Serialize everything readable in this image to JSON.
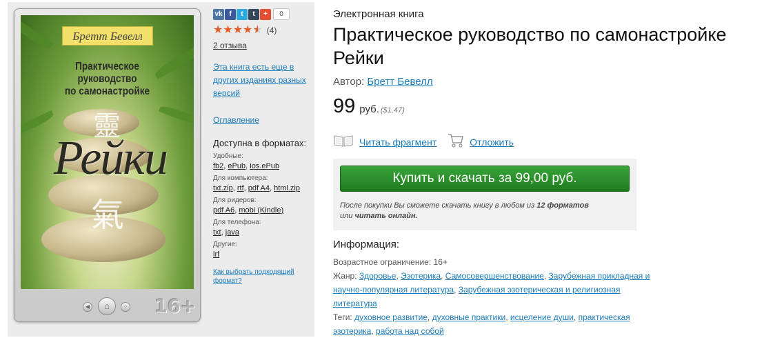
{
  "sidebar": {
    "share_count": "0",
    "rating_count": "(4)",
    "reviews_link": "2 отзыва",
    "other_editions_link": "Эта книга есть еще в других изданиях разных версий",
    "toc_link": "Оглавление",
    "formats_heading": "Доступна в форматах:",
    "format_groups": [
      {
        "label": "Удобные:",
        "formats": [
          "fb2",
          "ePub",
          "ios.ePub"
        ]
      },
      {
        "label": "Для компьютера:",
        "formats": [
          "txt.zip",
          "rtf",
          "pdf A4",
          "html.zip"
        ]
      },
      {
        "label": "Для ридеров:",
        "formats": [
          "pdf A6",
          "mobi (Kindle)"
        ]
      },
      {
        "label": "Для телефона:",
        "formats": [
          "txt",
          "java"
        ]
      },
      {
        "label": "Другие:",
        "formats": [
          "lrf"
        ]
      }
    ],
    "choose_format_link": "Как выбрать подходящий формат?",
    "share_icons": [
      "vk-icon",
      "facebook-icon",
      "twitter-icon",
      "tumblr-icon",
      "plus-icon"
    ],
    "share_glyphs": [
      "vk",
      "f",
      "t",
      "t",
      "+"
    ],
    "share_colors": [
      "#4c75a3",
      "#3b5998",
      "#2ea9df",
      "#35465c",
      "#e44f34"
    ],
    "rating_value": 4.5
  },
  "cover": {
    "author": "Бретт Бевелл",
    "title_lines": [
      "Практическое",
      "руководство",
      "по самонастройке"
    ],
    "big_title": "Рейки",
    "kanji_top": "靈",
    "kanji_bottom": "氣",
    "age_badge": "16+"
  },
  "main": {
    "kind": "Электронная книга",
    "title": "Практическое руководство по самонастройке Рейки",
    "author_label": "Автор:",
    "author_name": "Бретт Бевелл",
    "price": "99",
    "price_unit": "руб.",
    "price_usd": "($1,47)",
    "read_fragment": "Читать фрагмент",
    "postpone": "Отложить",
    "buy_button": "Купить и скачать за 99,00 руб.",
    "buy_note_1": "После покупки Вы сможете скачать книгу в любом из",
    "buy_note_bold_1": "12 форматов",
    "buy_note_2": "или",
    "buy_note_bold_2": "читать онлайн.",
    "info_heading": "Информация:",
    "age_label": "Возрастное ограничение:",
    "age_value": "16+",
    "genre_label": "Жанр:",
    "genres": [
      "Здоровье",
      "Эзотерика",
      "Самосовершенствование",
      "Зарубежная прикладная и научно-популярная литература",
      "Зарубежная эзотерическая и религиозная литература"
    ],
    "tags_label": "Теги:",
    "tags": [
      "духовное развитие",
      "духовные практики",
      "исцеление души",
      "практическая эзотерика",
      "работа над собой"
    ]
  }
}
